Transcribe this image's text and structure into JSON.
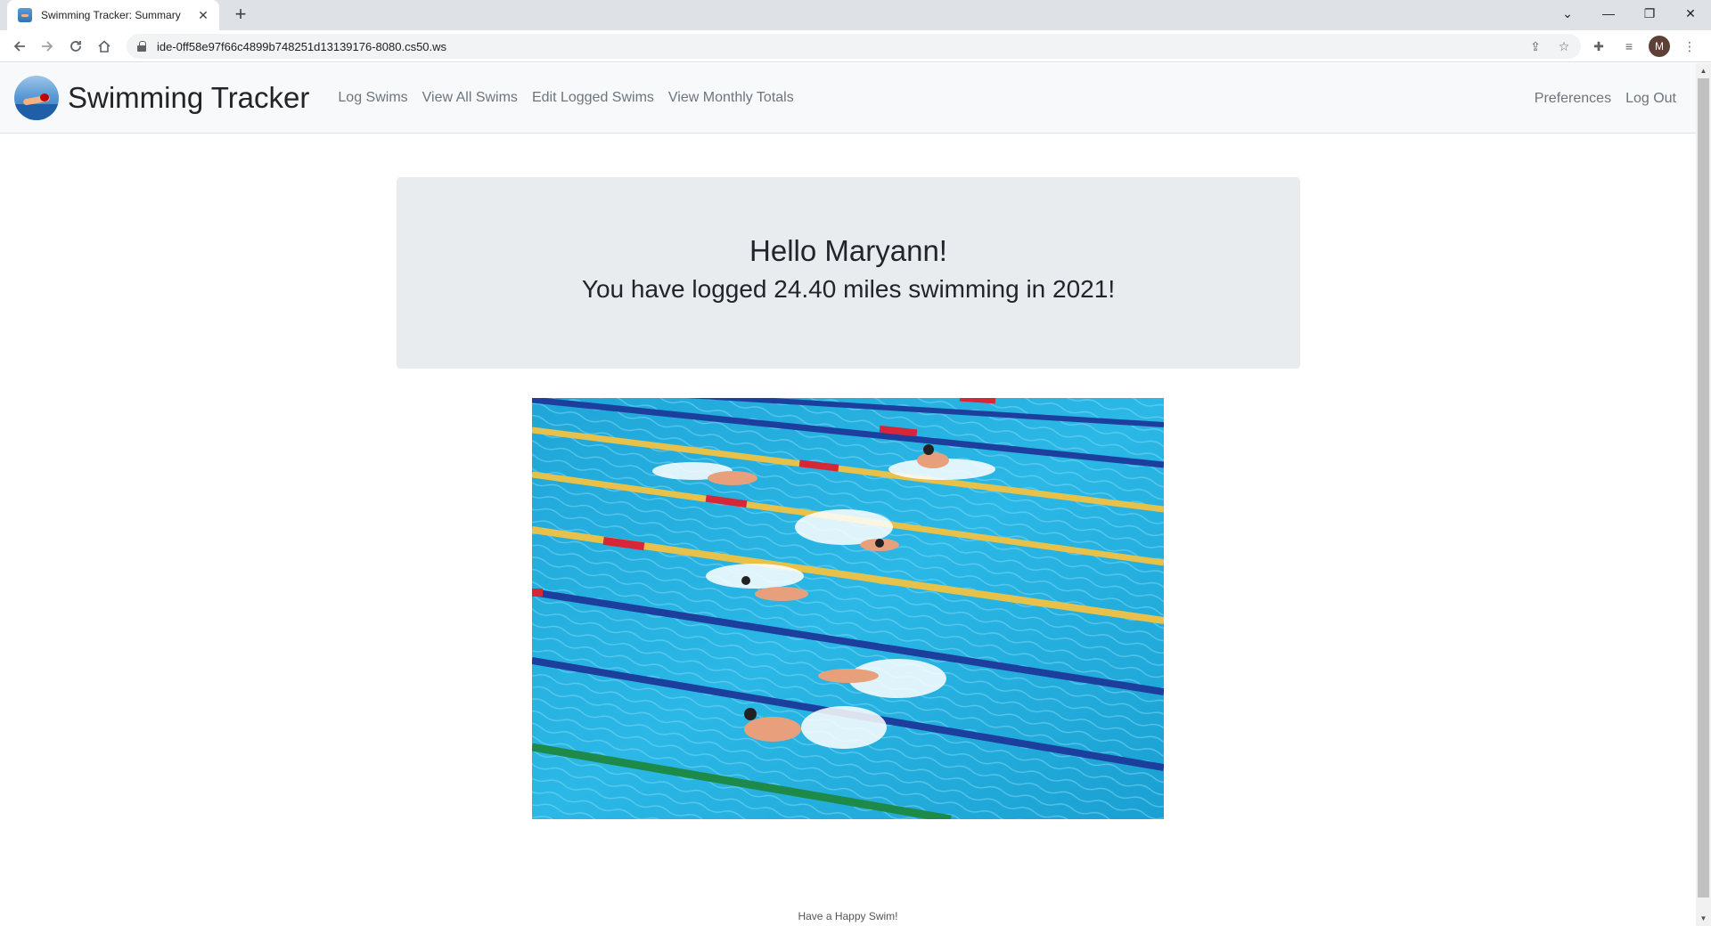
{
  "browser": {
    "tab_title": "Swimming Tracker: Summary",
    "url": "ide-0ff58e97f66c4899b748251d13139176-8080.cs50.ws",
    "profile_initial": "M"
  },
  "navbar": {
    "brand": "Swimming Tracker",
    "links": [
      "Log Swims",
      "View All Swims",
      "Edit Logged Swims",
      "View Monthly Totals"
    ],
    "right_links": [
      "Preferences",
      "Log Out"
    ]
  },
  "summary": {
    "greeting": "Hello Maryann!",
    "mileage": "You have logged 24.40 miles swimming in 2021!"
  },
  "footer": {
    "text": "Have a Happy Swim!"
  }
}
